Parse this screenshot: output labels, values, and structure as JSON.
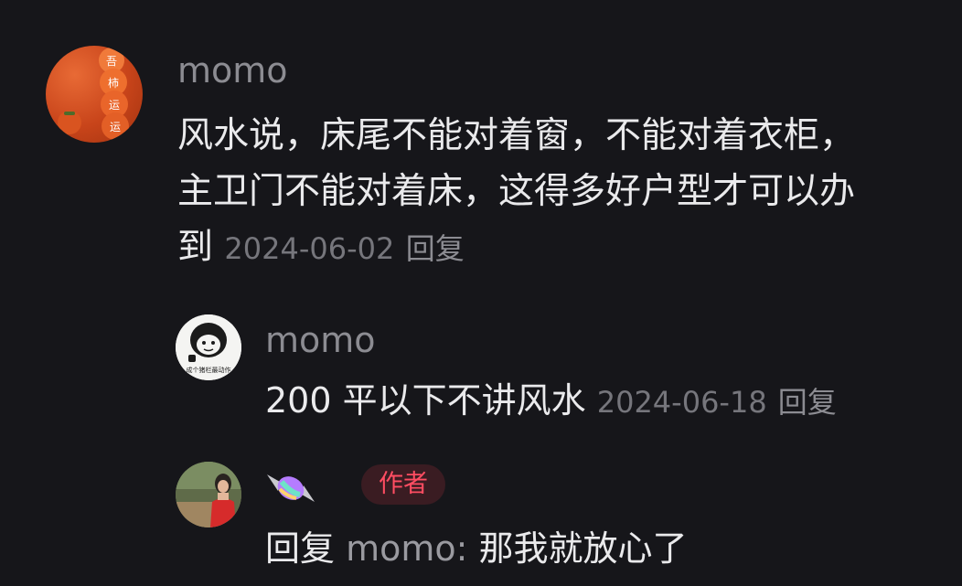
{
  "comments": [
    {
      "username": "momo",
      "lines": [
        "风水说，床尾不能对着窗，不能对着衣柜，",
        "主卫门不能对着床，这得多好户型才可以办",
        "到"
      ],
      "date": "2024-06-02",
      "reply_label": "回复",
      "avatar_chars": [
        "吾",
        "柿",
        "运",
        "运"
      ]
    },
    {
      "username": "momo",
      "text": "200 平以下不讲风水",
      "date": "2024-06-18",
      "reply_label": "回复",
      "avatar_caption": "成个猪栏最动作"
    },
    {
      "author_badge": "作者",
      "reply_prefix": "回复",
      "mention": "momo:",
      "text": "那我就放心了"
    }
  ],
  "colors": {
    "background": "#16161a",
    "text": "#eaeaec",
    "meta": "#76767c",
    "badge_text": "#ff4d62",
    "badge_bg": "#3a1c22"
  }
}
